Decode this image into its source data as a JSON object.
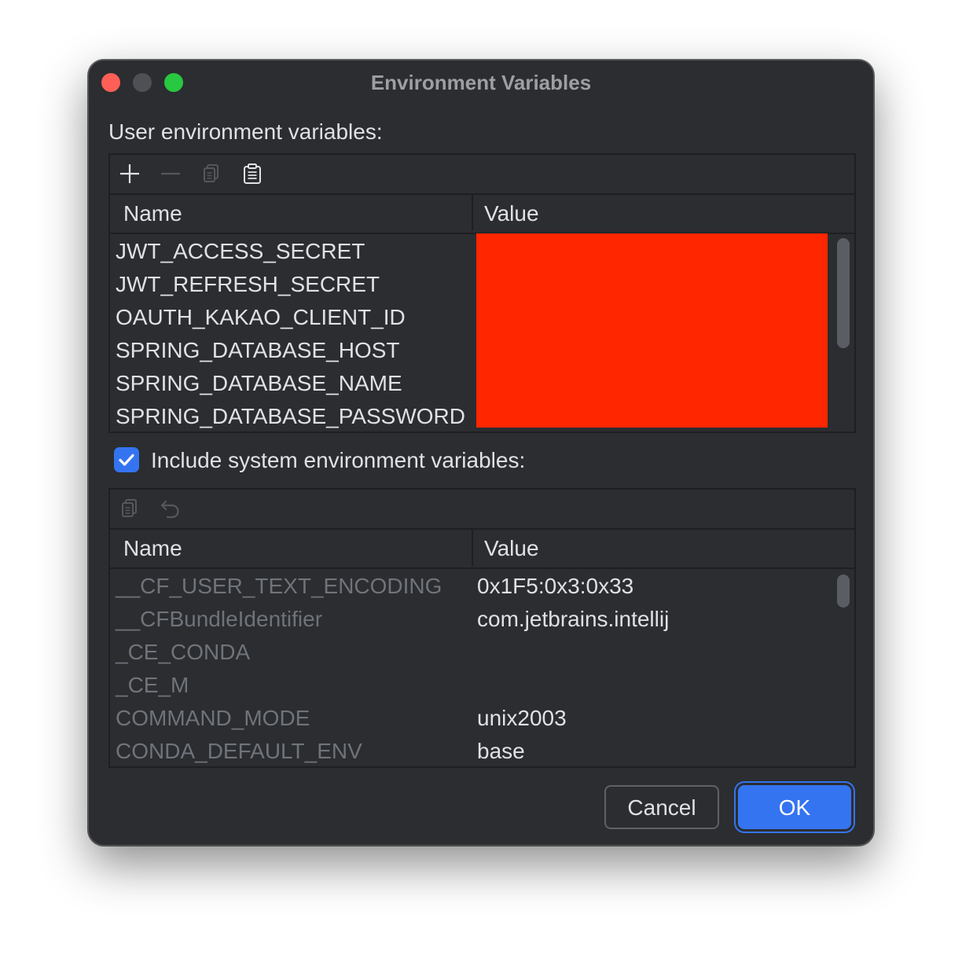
{
  "window": {
    "title": "Environment Variables"
  },
  "user_section": {
    "label": "User environment variables:",
    "toolbar": [
      "add-icon",
      "remove-icon",
      "copy-icon",
      "paste-icon"
    ],
    "columns": {
      "name": "Name",
      "value": "Value"
    },
    "rows": [
      {
        "name": "JWT_ACCESS_SECRET",
        "value": ""
      },
      {
        "name": "JWT_REFRESH_SECRET",
        "value": ""
      },
      {
        "name": "OAUTH_KAKAO_CLIENT_ID",
        "value": ""
      },
      {
        "name": "SPRING_DATABASE_HOST",
        "value": ""
      },
      {
        "name": "SPRING_DATABASE_NAME",
        "value": ""
      },
      {
        "name": "SPRING_DATABASE_PASSWORD",
        "value": ""
      }
    ],
    "values_redacted": true,
    "redaction_color": "#ff2600"
  },
  "system_section": {
    "checkbox_label": "Include system environment variables:",
    "checked": true,
    "toolbar": [
      "copy-icon",
      "undo-icon"
    ],
    "columns": {
      "name": "Name",
      "value": "Value"
    },
    "rows": [
      {
        "name": "__CF_USER_TEXT_ENCODING",
        "value": "0x1F5:0x3:0x33"
      },
      {
        "name": "__CFBundleIdentifier",
        "value": "com.jetbrains.intellij"
      },
      {
        "name": "_CE_CONDA",
        "value": ""
      },
      {
        "name": "_CE_M",
        "value": ""
      },
      {
        "name": "COMMAND_MODE",
        "value": "unix2003"
      },
      {
        "name": "CONDA_DEFAULT_ENV",
        "value": "base"
      }
    ]
  },
  "buttons": {
    "cancel": "Cancel",
    "ok": "OK"
  },
  "colors": {
    "background": "#2b2d30",
    "accent": "#3574f0",
    "text": "#dfe1e5",
    "dim_text": "#6f737a"
  }
}
